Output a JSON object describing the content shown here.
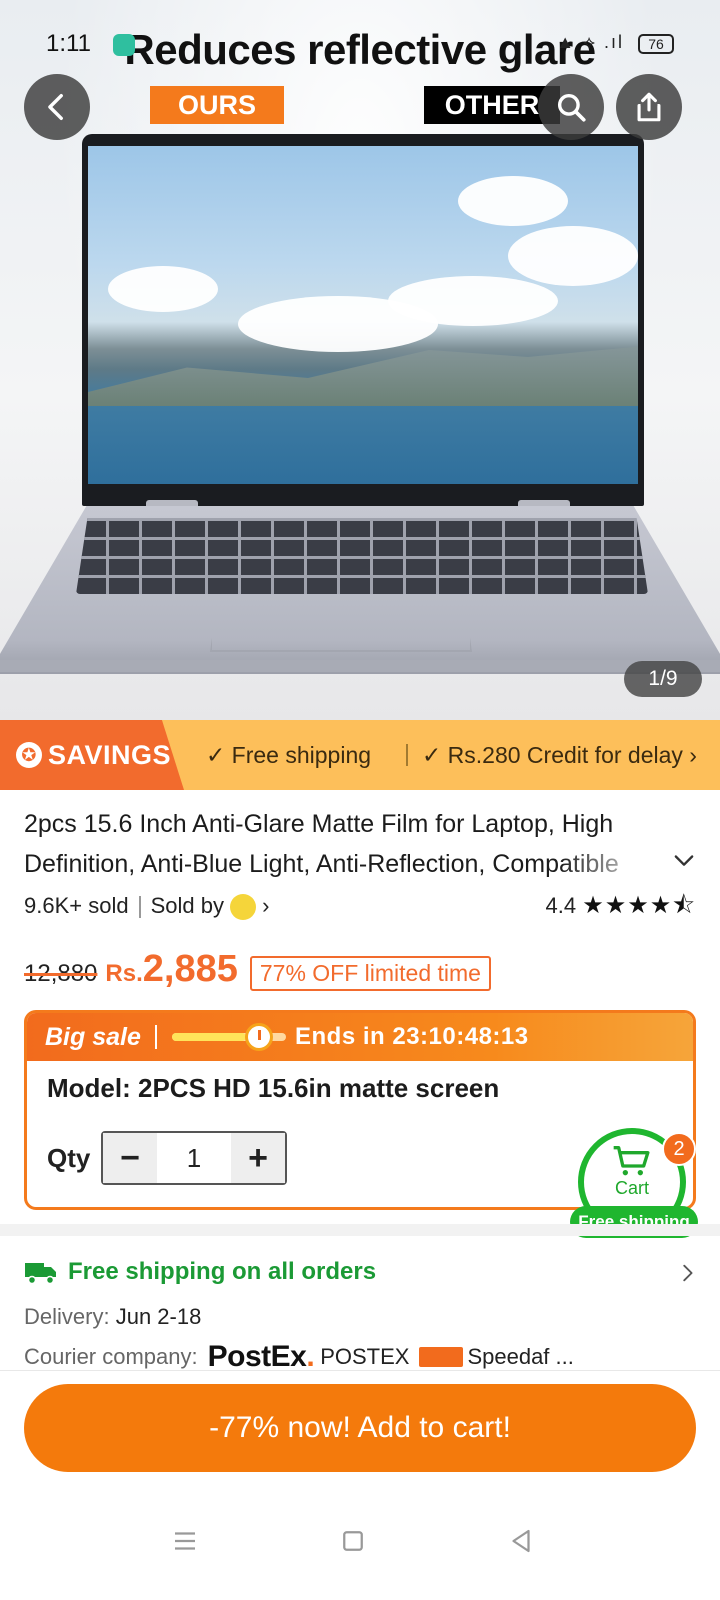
{
  "status_bar": {
    "time": "1:11",
    "signal": "▲ ⟡ .ıl",
    "battery": "76"
  },
  "hero": {
    "caption": "Reduces reflective glare",
    "tag_ours": "OURS",
    "tag_other": "OTHER",
    "counter": "1/9"
  },
  "band": {
    "savings_label": "SAVINGS",
    "perk1": "Free shipping",
    "perk2": "Rs.280 Credit for delay"
  },
  "product": {
    "title": "2pcs 15.6 Inch Anti-Glare Matte Film for Laptop, High Definition, Anti-Blue Light, Anti-Reflection, Compatible",
    "sold": "9.6K+ sold",
    "sold_by": "Sold by",
    "rating": "4.4",
    "stars": "★★★★⯪",
    "old_price": "12,880",
    "currency": "Rs.",
    "price": "2,885",
    "discount": "77% OFF limited time"
  },
  "sale": {
    "label": "Big sale",
    "ends": "Ends in 23:10:48:13",
    "progress": 0.65,
    "model": "Model: 2PCS HD 15.6in matte screen",
    "qty_label": "Qty",
    "qty": "1"
  },
  "cart": {
    "label": "Cart",
    "count": "2",
    "free": "Free shipping"
  },
  "shipping": {
    "headline": "Free shipping on all orders",
    "delivery_key": "Delivery:",
    "delivery_val": "Jun 2-18",
    "courier_key": "Courier company:",
    "postex_logo": "PostEx",
    "courier1": "POSTEX",
    "courier2": "Speedaf ..."
  },
  "cta": "-77% now! Add to cart!",
  "colors": {
    "accent": "#f47a0c",
    "green": "#1fb62f",
    "band": "#fdbf5a"
  }
}
